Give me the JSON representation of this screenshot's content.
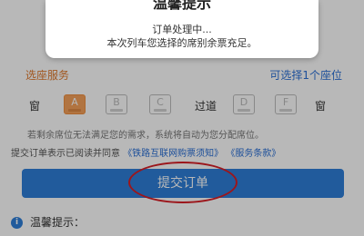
{
  "dialog": {
    "title": "温馨提示",
    "line1": "订单处理中...",
    "line2": "本次列车您选择的席别余票充足。"
  },
  "seat_section": {
    "title": "选座服务",
    "count_text": "可选择1个座位",
    "window_label": "窗",
    "aisle_label": "过道",
    "seats": [
      "A",
      "B",
      "C",
      "D",
      "F"
    ],
    "selected_seat": "A",
    "note": "若剩余席位无法满足您的需求，系统将自动为您分配席位。"
  },
  "agreement": {
    "prefix": "提交订单表示已阅读并同意",
    "link1": "《铁路互联网购票须知》",
    "link2": "《服务条款》"
  },
  "submit_button": {
    "label": "提交订单"
  },
  "tips": {
    "label": "温馨提示："
  },
  "colors": {
    "accent_blue": "#2e7fd9",
    "seat_selected": "#f5a15a",
    "highlight_circle": "#d81f26",
    "section_orange": "#e07a2f"
  }
}
